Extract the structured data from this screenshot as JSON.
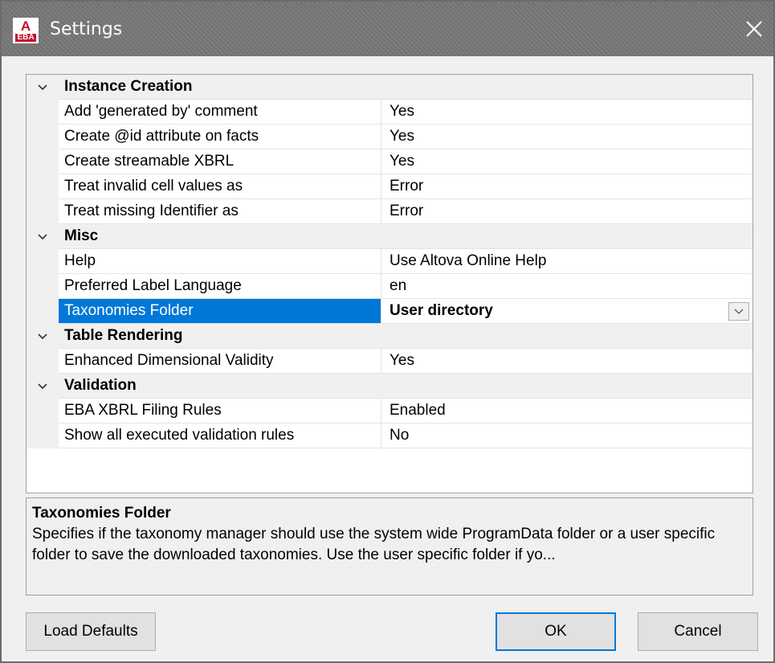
{
  "window": {
    "title": "Settings",
    "app_icon": "eba-icon"
  },
  "categories": [
    {
      "label": "Instance Creation",
      "items": [
        {
          "name": "Add 'generated by' comment",
          "value": "Yes"
        },
        {
          "name": "Create @id attribute on facts",
          "value": "Yes"
        },
        {
          "name": "Create streamable XBRL",
          "value": "Yes"
        },
        {
          "name": "Treat invalid cell values as",
          "value": "Error"
        },
        {
          "name": "Treat missing Identifier as",
          "value": "Error"
        }
      ]
    },
    {
      "label": "Misc",
      "items": [
        {
          "name": "Help",
          "value": "Use Altova Online Help"
        },
        {
          "name": "Preferred Label Language",
          "value": "en"
        },
        {
          "name": "Taxonomies Folder",
          "value": "User directory"
        }
      ]
    },
    {
      "label": "Table Rendering",
      "items": [
        {
          "name": "Enhanced Dimensional Validity",
          "value": "Yes"
        }
      ]
    },
    {
      "label": "Validation",
      "items": [
        {
          "name": "EBA XBRL Filing Rules",
          "value": "Enabled"
        },
        {
          "name": "Show all executed validation rules",
          "value": "No"
        }
      ]
    }
  ],
  "help": {
    "title": "Taxonomies Folder",
    "description": "Specifies if the taxonomy manager should use the system wide ProgramData folder or a user specific folder to save the downloaded taxonomies. Use the user specific folder if yo..."
  },
  "buttons": {
    "load_defaults": "Load Defaults",
    "ok": "OK",
    "cancel": "Cancel"
  },
  "colors": {
    "selection": "#0078d7",
    "titlebar": "#777777"
  }
}
